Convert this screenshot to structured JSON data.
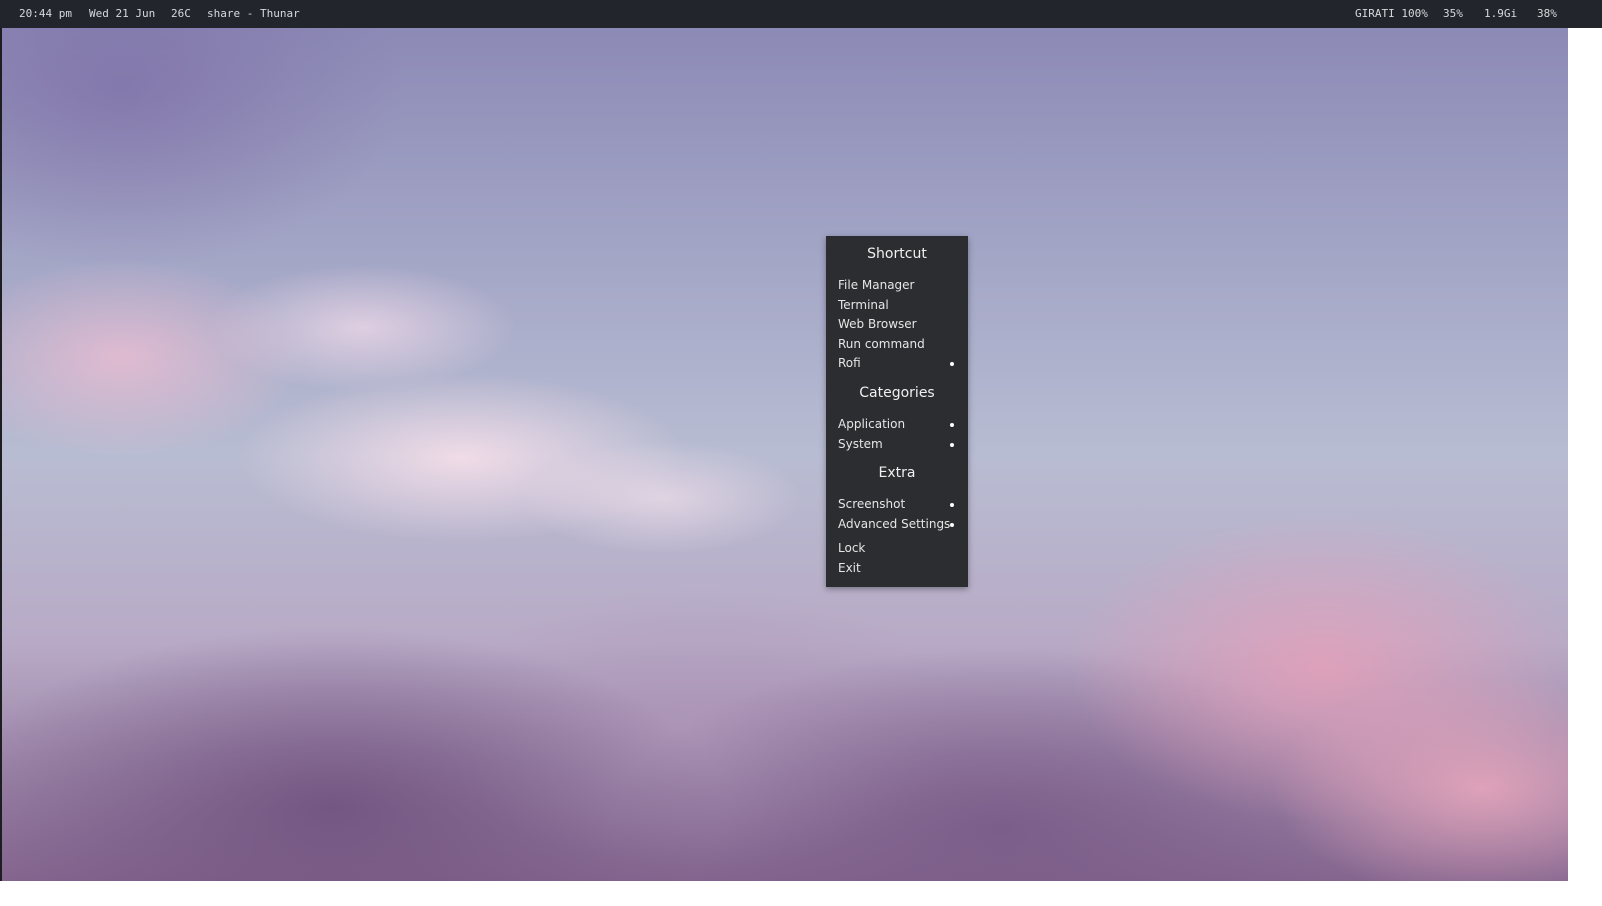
{
  "topbar": {
    "time": "20:44 pm",
    "date": "Wed 21 Jun",
    "temperature": "26C",
    "window_title": "share - Thunar",
    "network": "GIRATI 100%",
    "cpu": "35%",
    "memory": "1.9Gi",
    "battery": "38%"
  },
  "menu": {
    "sections": [
      {
        "title": "Shortcut",
        "items": [
          {
            "label": "File Manager",
            "submenu": false
          },
          {
            "label": "Terminal",
            "submenu": false
          },
          {
            "label": "Web Browser",
            "submenu": false
          },
          {
            "label": "Run command",
            "submenu": false
          },
          {
            "label": "Rofi",
            "submenu": true
          }
        ]
      },
      {
        "title": "Categories",
        "items": [
          {
            "label": "Application",
            "submenu": true
          },
          {
            "label": "System",
            "submenu": true
          }
        ]
      },
      {
        "title": "Extra",
        "items": [
          {
            "label": "Screenshot",
            "submenu": true
          },
          {
            "label": "Advanced Settings",
            "submenu": true
          },
          {
            "label": "Lock",
            "submenu": false
          },
          {
            "label": "Exit",
            "submenu": false
          }
        ]
      }
    ]
  },
  "colors": {
    "topbar_bg": "#22262c",
    "menu_bg": "#2b2d30",
    "menu_text": "#e6e6e6"
  }
}
